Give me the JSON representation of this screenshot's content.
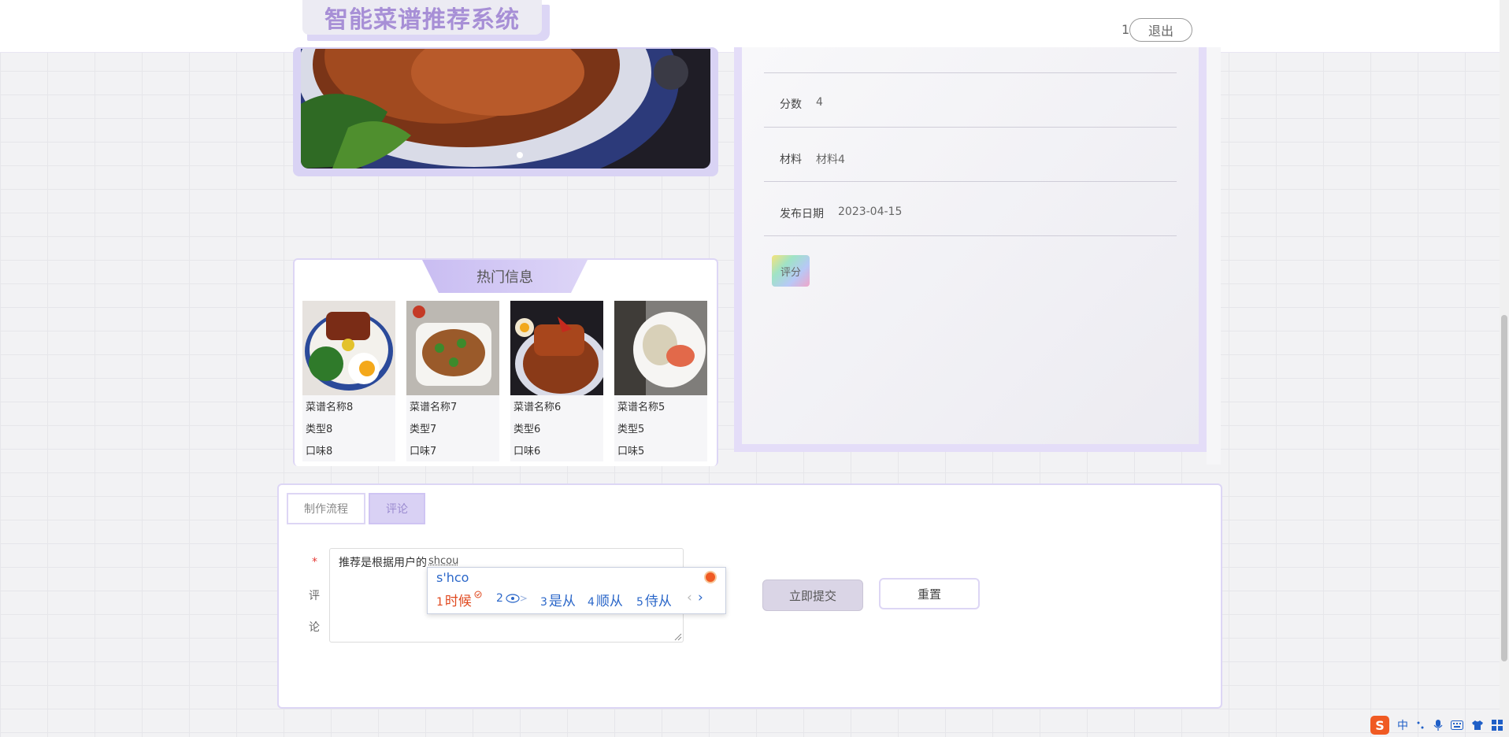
{
  "header": {
    "logo_text": "智能菜谱推荐系统",
    "user_name": "1",
    "logout_label": "退出"
  },
  "hot": {
    "title": "热门信息",
    "items": [
      {
        "name": "菜谱名称8",
        "type": "类型8",
        "taste": "口味8"
      },
      {
        "name": "菜谱名称7",
        "type": "类型7",
        "taste": "口味7"
      },
      {
        "name": "菜谱名称6",
        "type": "类型6",
        "taste": "口味6"
      },
      {
        "name": "菜谱名称5",
        "type": "类型5",
        "taste": "口味5"
      }
    ]
  },
  "detail": {
    "fields": [
      {
        "label": "分数",
        "value": "4"
      },
      {
        "label": "材料",
        "value": "材料4"
      },
      {
        "label": "发布日期",
        "value": "2023-04-15"
      }
    ],
    "rate_label": "评分"
  },
  "tabs": {
    "process": "制作流程",
    "comment": "评论"
  },
  "comment": {
    "required_mark": "*",
    "label_chars": [
      "评",
      "论"
    ],
    "text": "推荐是根据用户的",
    "typing": "shcou",
    "submit_label": "立即提交",
    "reset_label": "重置"
  },
  "ime": {
    "input": "s'hco",
    "candidates": [
      {
        "num": "1",
        "text": "时候"
      },
      {
        "num": "2",
        "text": ""
      },
      {
        "num": "3",
        "text": "是从"
      },
      {
        "num": "4",
        "text": "顺从"
      },
      {
        "num": "5",
        "text": "侍从"
      }
    ],
    "prev_label": "‹",
    "next_label": "›"
  },
  "tray": {
    "ime_logo": "S",
    "lang": "中"
  },
  "colors": {
    "accent": "#a78fd6",
    "panel_border": "#ddd6f5"
  }
}
